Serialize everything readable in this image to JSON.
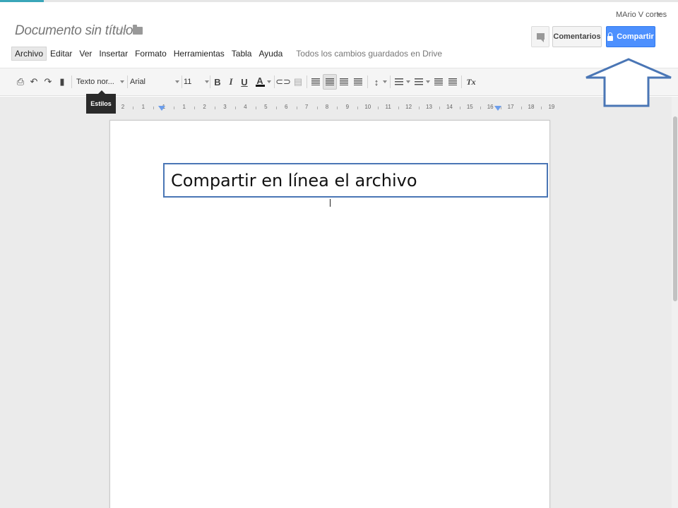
{
  "document": {
    "title": "Documento sin título",
    "star_icon": "star-icon",
    "folder_icon": "folder-icon",
    "save_status": "Todos los cambios guardados en Drive"
  },
  "menu": {
    "items": [
      "Archivo",
      "Editar",
      "Ver",
      "Insertar",
      "Formato",
      "Herramientas",
      "Tabla",
      "Ayuda"
    ],
    "active": "Archivo"
  },
  "user": {
    "name": "MArio V cortes"
  },
  "header_buttons": {
    "comments_label": "Comentarios",
    "share_label": "Compartir",
    "share_color": "#4d90fe"
  },
  "toolbar": {
    "style_value": "Texto nor...",
    "font_value": "Arial",
    "size_value": "11",
    "bold": "B",
    "italic": "I",
    "underline": "U",
    "text_color": "A",
    "clear_format": "Tx",
    "active_alignment": "center"
  },
  "tooltip": {
    "text": "Estilos"
  },
  "ruler": {
    "labels": [
      "2",
      "1",
      "1",
      "1",
      "2",
      "3",
      "4",
      "5",
      "6",
      "7",
      "8",
      "9",
      "10",
      "11",
      "12",
      "13",
      "14",
      "15",
      "16",
      "17",
      "18",
      "19"
    ]
  },
  "annotation": {
    "callout_text": "Compartir en línea el archivo",
    "border_color": "#4a76b5",
    "arrow_color": "#4a76b5",
    "arrow_direction": "up"
  }
}
